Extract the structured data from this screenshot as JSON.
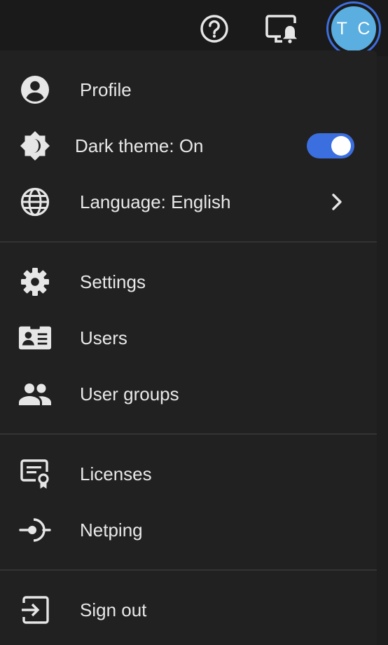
{
  "header": {
    "help_icon": "help-circle-icon",
    "notifications_icon": "desktop-notification-icon",
    "avatar_initials": "T C",
    "avatar_color": "#5aaee0",
    "avatar_ring_color": "#3d6fe0"
  },
  "menu": {
    "profile": {
      "label": "Profile",
      "icon": "account-circle-icon"
    },
    "dark_theme": {
      "label": "Dark theme: On",
      "icon": "theme-icon",
      "toggle_on": true,
      "toggle_color": "#3b6fe0"
    },
    "language": {
      "label": "Language: English",
      "icon": "globe-icon"
    },
    "settings": {
      "label": "Settings",
      "icon": "gear-icon"
    },
    "users": {
      "label": "Users",
      "icon": "id-card-icon"
    },
    "user_groups": {
      "label": "User groups",
      "icon": "people-icon"
    },
    "licenses": {
      "label": "Licenses",
      "icon": "license-certificate-icon"
    },
    "netping": {
      "label": "Netping",
      "icon": "netping-icon"
    },
    "sign_out": {
      "label": "Sign out",
      "icon": "sign-out-icon"
    }
  }
}
